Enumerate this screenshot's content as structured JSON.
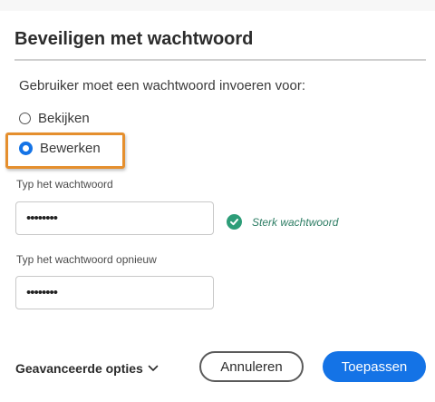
{
  "dialog": {
    "title": "Beveiligen met wachtwoord",
    "prompt": "Gebruiker moet een wachtwoord invoeren voor:"
  },
  "options": [
    {
      "label": "Bekijken",
      "selected": false
    },
    {
      "label": "Bewerken",
      "selected": true
    }
  ],
  "fields": {
    "password_label": "Typ het wachtwoord",
    "password_value": "••••••••",
    "confirm_label": "Typ het wachtwoord opnieuw",
    "confirm_value": "••••••••"
  },
  "strength": {
    "icon": "checkmark-circle-icon",
    "text": "Sterk wachtwoord",
    "color": "#2d9d78"
  },
  "footer": {
    "advanced_label": "Geavanceerde opties",
    "cancel_label": "Annuleren",
    "apply_label": "Toepassen"
  },
  "colors": {
    "accent": "#1473e6",
    "highlight": "#e58f2e"
  }
}
